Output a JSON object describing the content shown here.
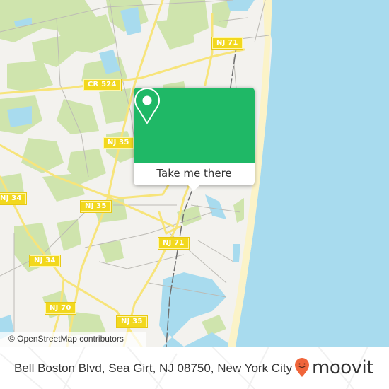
{
  "map": {
    "colors": {
      "land": "#f3f2ee",
      "park": "#cfe4ad",
      "water": "#a8dbee",
      "beach": "#fbf3c8",
      "road_major": "#f7e47a",
      "road_minor": "#bdbbb5",
      "rail": "#6f6f6f"
    },
    "road_labels": [
      {
        "id": "nj71-north",
        "text": "NJ 71"
      },
      {
        "id": "cr524",
        "text": "CR 524"
      },
      {
        "id": "nj35-upper",
        "text": "NJ 35"
      },
      {
        "id": "nj34-west",
        "text": "NJ 34"
      },
      {
        "id": "nj35-mid",
        "text": "NJ 35"
      },
      {
        "id": "nj71-south",
        "text": "NJ 71"
      },
      {
        "id": "nj34-south",
        "text": "NJ 34"
      },
      {
        "id": "nj70",
        "text": "NJ 70"
      },
      {
        "id": "nj35-south",
        "text": "NJ 35"
      }
    ],
    "attribution": "© OpenStreetMap contributors"
  },
  "popup": {
    "icon": "map-pin-icon",
    "button_label": "Take me there",
    "accent_color": "#1fb866"
  },
  "footer": {
    "address": "Bell Boston Blvd, Sea Girt, NJ 08750, New York City",
    "logo_icon": "moovit-pin-icon",
    "logo_text": "moovit",
    "logo_color": "#f0653a"
  }
}
